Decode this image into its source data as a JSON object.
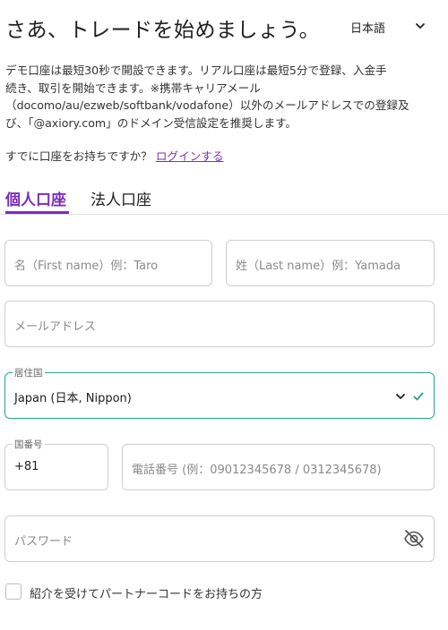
{
  "header": {
    "title": "さあ、トレードを始めましょう。",
    "language": "日本語"
  },
  "intro": {
    "line1": "デモ口座は最短30秒で開設できます。リアル口座は最短5分で登録、入金手",
    "line2": "続き、取引を開始できます。※携帯キャリアメール",
    "line3": "（docomo/au/ezweb/softbank/vodafone）以外のメールアドレスでの登録及",
    "line4": "び、「@axiory.com」のドメイン受信設定を推奨します。"
  },
  "login": {
    "prompt": "すでに口座をお持ちですか？",
    "link": "ログインする"
  },
  "tabs": [
    {
      "label": "個人口座",
      "active": true
    },
    {
      "label": "法人口座",
      "active": false
    }
  ],
  "form": {
    "first_name_placeholder": "名（First name）例：Taro",
    "last_name_placeholder": "姓（Last name）例：Yamada",
    "email_placeholder": "メールアドレス",
    "country_label": "居住国",
    "country_value": "Japan (日本, Nippon)",
    "phone_code_label": "国番号",
    "phone_code_value": "+81",
    "phone_placeholder": "電話番号 (例：09012345678 / 0312345678)",
    "password_placeholder": "パスワード",
    "referral_label": "紹介を受けてパートナーコードをお持ちの方"
  },
  "colors": {
    "accent": "#7a2fb8",
    "valid": "#2aa58a",
    "border": "#cfcfcf"
  },
  "icons": {
    "language_dropdown": "chevron-down-icon",
    "country_dropdown": "chevron-down-icon",
    "country_valid": "check-icon",
    "password_toggle": "eye-off-icon"
  }
}
